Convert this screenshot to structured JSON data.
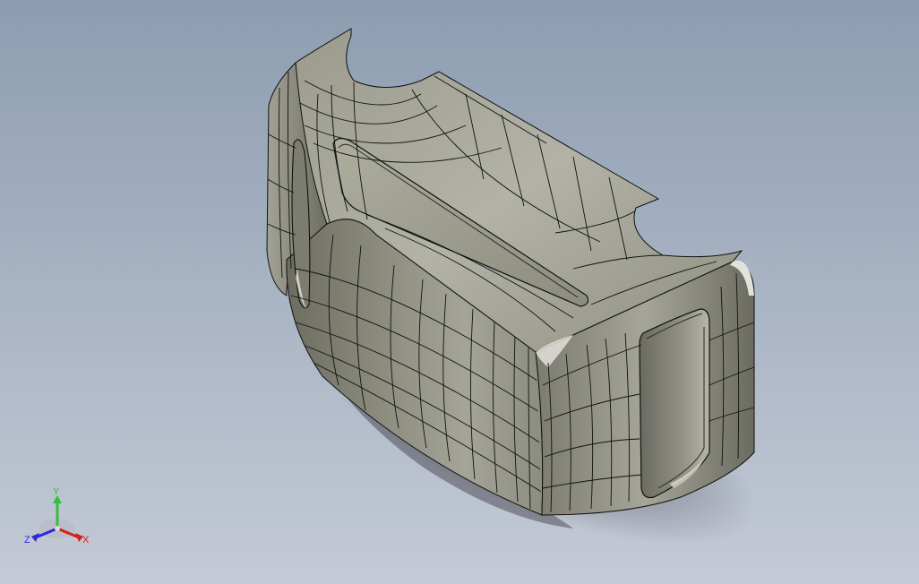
{
  "viewport": {
    "background_top": "#8d9db1",
    "background_bottom": "#c4cad6"
  },
  "model": {
    "surface_light": "#a9a99c",
    "surface_mid": "#8f8f82",
    "surface_dark": "#5d5d52",
    "edge_color": "#111111",
    "shadow_color": "#4c4c55"
  },
  "triad": {
    "y_label": "Y",
    "x_label": "X",
    "z_label": "Z",
    "y_color": "#2fbf3a",
    "x_color": "#d41f1f",
    "z_color": "#2a2ad8"
  }
}
